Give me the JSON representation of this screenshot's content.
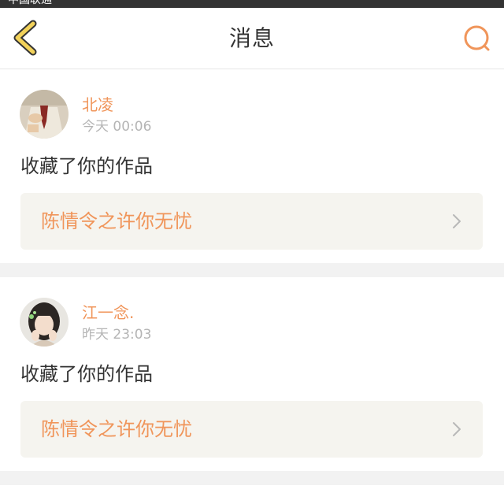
{
  "status_bar": {
    "carrier": "中国联通"
  },
  "header": {
    "title": "消息",
    "back_icon": "chevron-left-icon",
    "search_icon": "search-icon"
  },
  "colors": {
    "accent": "#f0955a",
    "back_icon": "#f2d25a",
    "text_primary": "#333333",
    "text_secondary": "#b5b5b5",
    "card_link_bg": "#f5f4ef",
    "page_bg": "#f2f2f2"
  },
  "messages": [
    {
      "username": "北凌",
      "time": "今天 00:06",
      "action": "收藏了你的作品",
      "work_title": "陈情令之许你无忧"
    },
    {
      "username": "江一念.",
      "time": "昨天 23:03",
      "action": "收藏了你的作品",
      "work_title": "陈情令之许你无忧"
    }
  ]
}
